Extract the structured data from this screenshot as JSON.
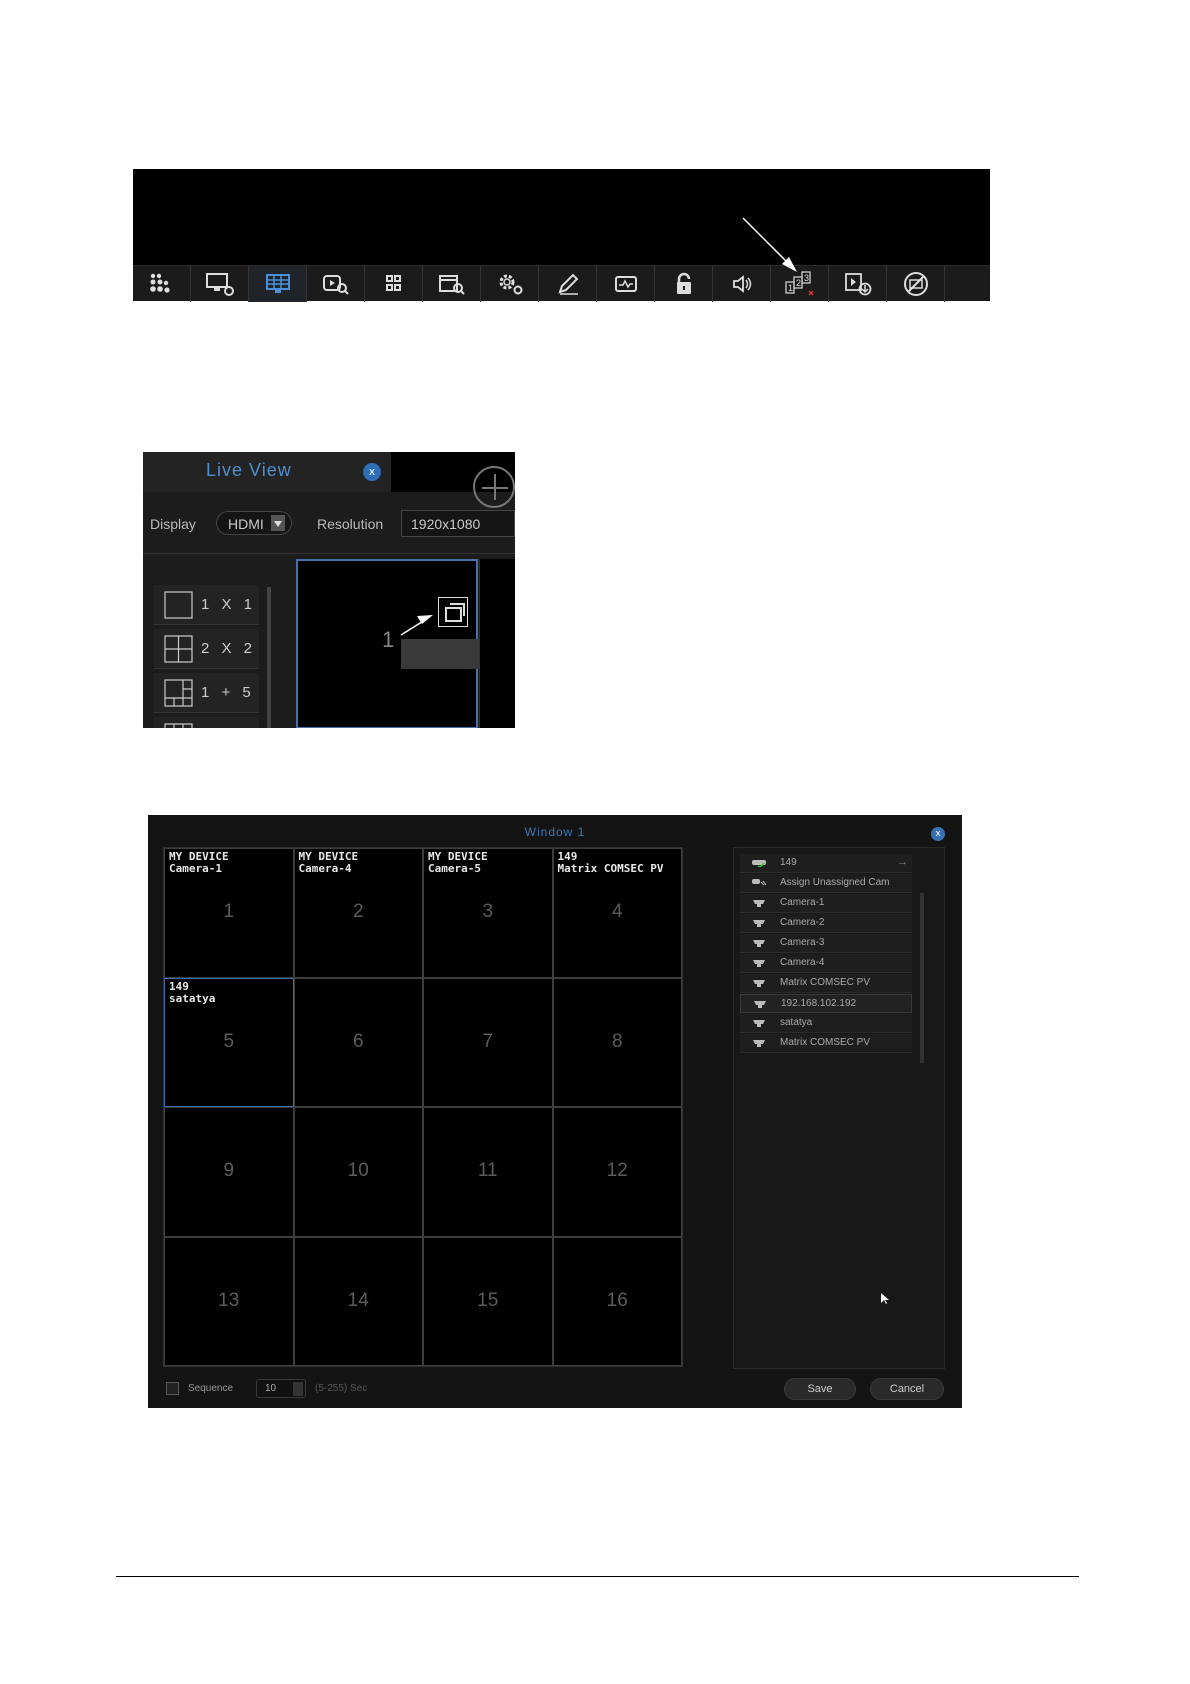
{
  "toolbar": {
    "icons": [
      "matrix-logo-icon",
      "display-settings-icon",
      "live-view-icon",
      "playback-search-icon",
      "layout-grid-icon",
      "event-search-icon",
      "settings-icon",
      "edit-icon",
      "system-status-icon",
      "lock-icon",
      "audio-icon",
      "sequence-icon",
      "backup-icon",
      "stop-recording-icon"
    ],
    "active_index": 2,
    "pointer_target": "sequence-icon"
  },
  "live_view": {
    "title": "Live View",
    "close_symbol": "x",
    "display_label": "Display",
    "display_value": "HDMI",
    "resolution_label": "Resolution",
    "resolution_value": "1920x1080",
    "layouts": [
      {
        "label": "1 X 1"
      },
      {
        "label": "2 X 2"
      },
      {
        "label": "1 + 5"
      }
    ],
    "tile_number": "1"
  },
  "window": {
    "title": "Window 1",
    "close_symbol": "x",
    "selected_cell": 5,
    "cells": [
      {
        "num": "1",
        "device": "MY DEVICE",
        "camera": "Camera-1"
      },
      {
        "num": "2",
        "device": "MY DEVICE",
        "camera": "Camera-4"
      },
      {
        "num": "3",
        "device": "MY DEVICE",
        "camera": "Camera-5"
      },
      {
        "num": "4",
        "device": "149",
        "camera": "Matrix COMSEC PV"
      },
      {
        "num": "5",
        "device": "149",
        "camera": "satatya"
      },
      {
        "num": "6",
        "device": "",
        "camera": ""
      },
      {
        "num": "7",
        "device": "",
        "camera": ""
      },
      {
        "num": "8",
        "device": "",
        "camera": ""
      },
      {
        "num": "9",
        "device": "",
        "camera": ""
      },
      {
        "num": "10",
        "device": "",
        "camera": ""
      },
      {
        "num": "11",
        "device": "",
        "camera": ""
      },
      {
        "num": "12",
        "device": "",
        "camera": ""
      },
      {
        "num": "13",
        "device": "",
        "camera": ""
      },
      {
        "num": "14",
        "device": "",
        "camera": ""
      },
      {
        "num": "15",
        "device": "",
        "camera": ""
      },
      {
        "num": "16",
        "device": "",
        "camera": ""
      }
    ],
    "device_list": {
      "device_name": "149",
      "assign_label": "Assign Unassigned Cam",
      "cameras": [
        "Camera-1",
        "Camera-2",
        "Camera-3",
        "Camera-4",
        "Matrix COMSEC PV",
        "192.168.102.192",
        "satatya",
        "Matrix COMSEC PV"
      ],
      "highlighted": "192.168.102.192"
    },
    "sequence_label": "Sequence",
    "sequence_value": "10",
    "sequence_range": "(5-255) Sec",
    "save_label": "Save",
    "cancel_label": "Cancel"
  }
}
